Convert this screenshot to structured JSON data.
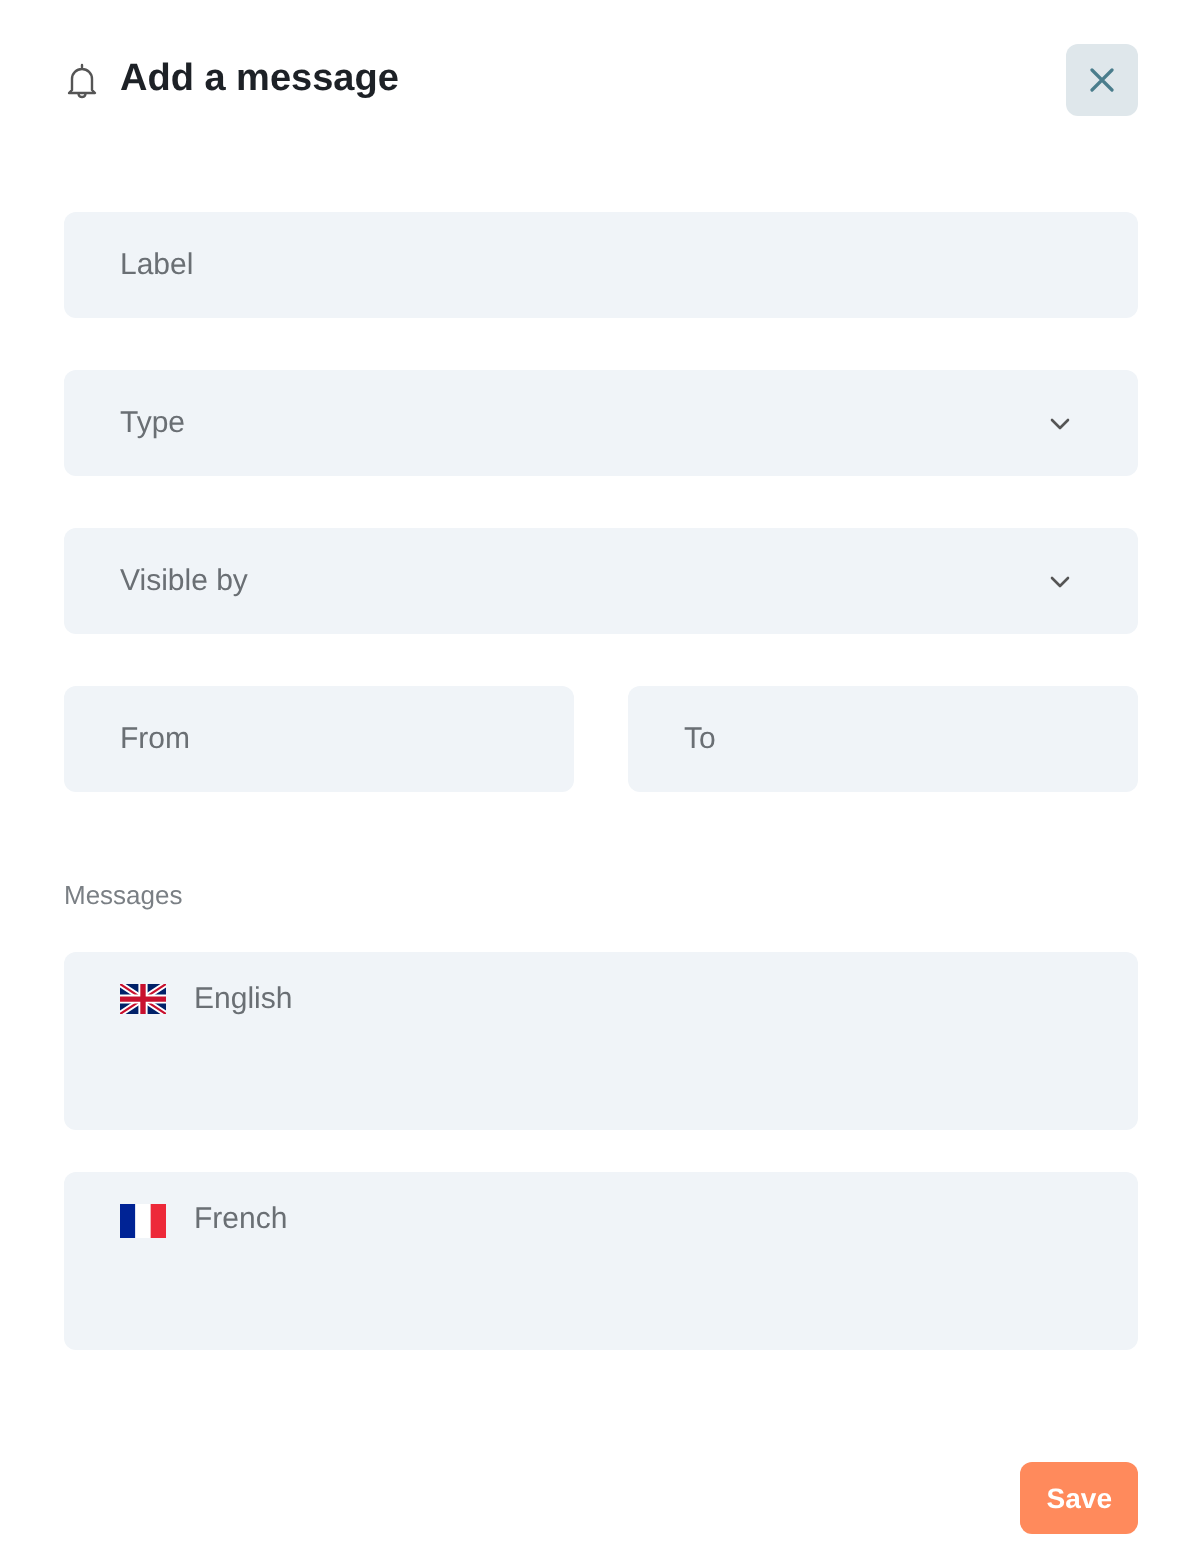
{
  "header": {
    "title": "Add a message"
  },
  "fields": [
    {
      "kind": "text",
      "placeholder": "Label"
    },
    {
      "kind": "select",
      "placeholder": "Type"
    },
    {
      "kind": "select",
      "placeholder": "Visible by"
    }
  ],
  "date_range": [
    {
      "placeholder": "From"
    },
    {
      "placeholder": "To"
    }
  ],
  "messages": {
    "label": "Messages",
    "items": [
      {
        "kind": "gb",
        "placeholder": "English"
      },
      {
        "kind": "fr",
        "placeholder": "French"
      }
    ]
  },
  "save_button": {
    "label": "Save"
  }
}
